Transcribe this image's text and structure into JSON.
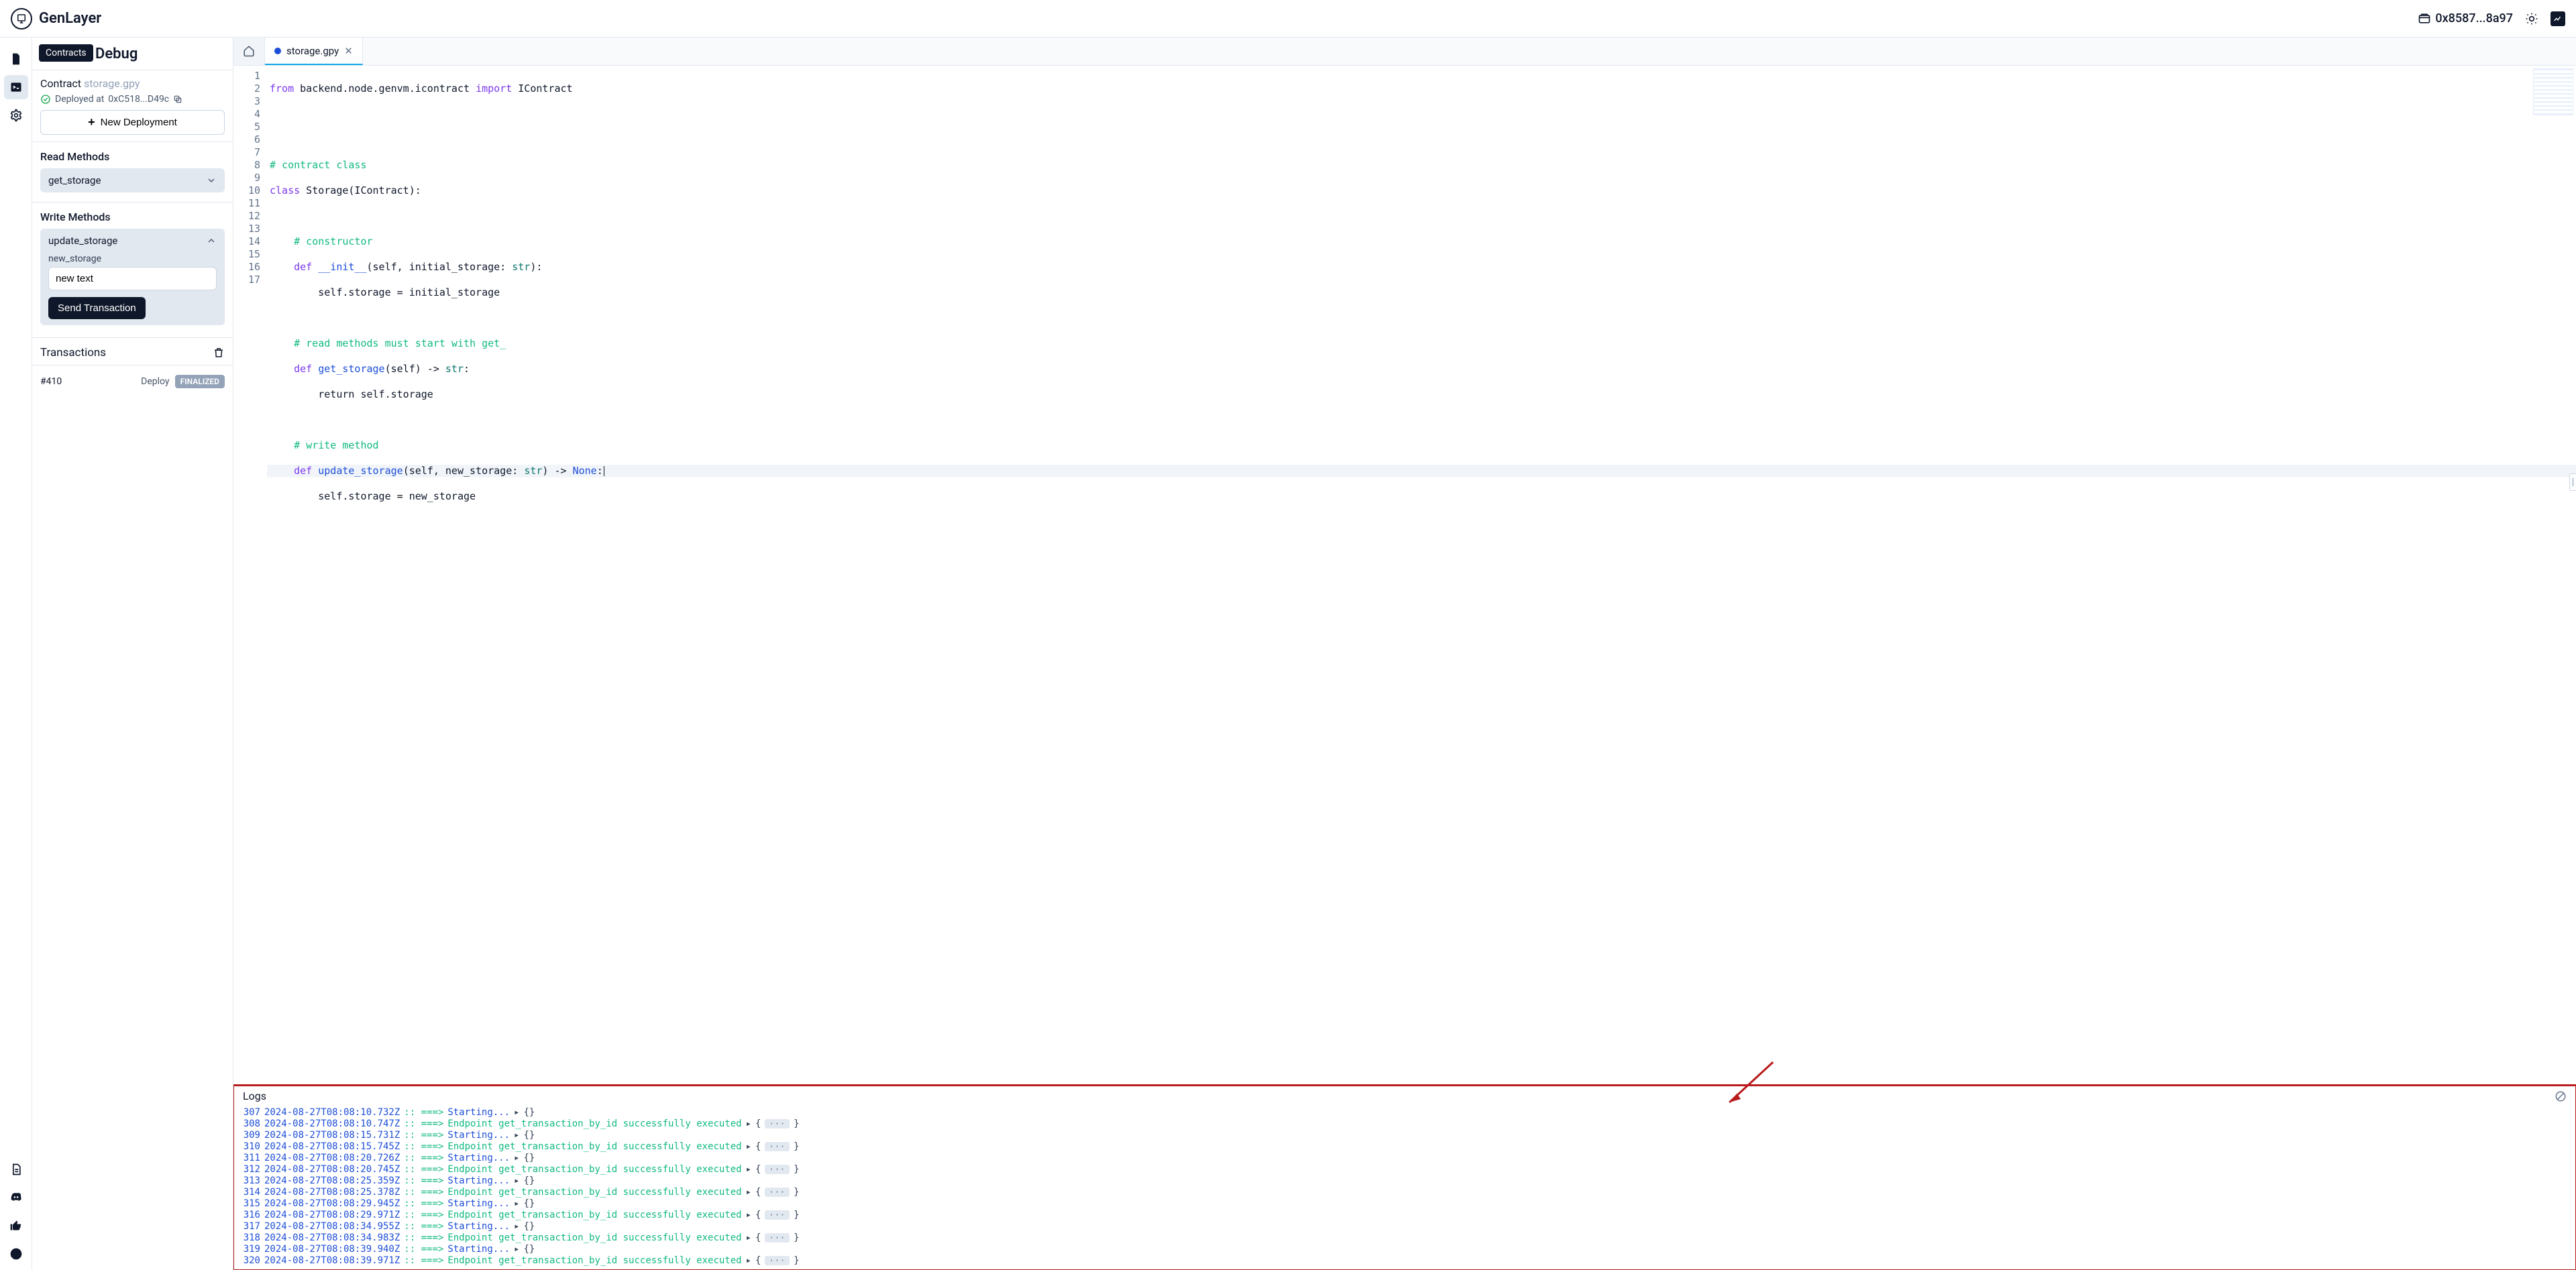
{
  "header": {
    "brand": "GenLayer",
    "wallet": "0x8587...8a97"
  },
  "tooltip": "Contracts",
  "sidebar": {
    "title": "Debug",
    "contract_label": "Contract",
    "contract_name": "storage.gpy",
    "deployed_prefix": "Deployed at",
    "deployed_addr": "0xC518...D49c",
    "new_deployment": "New Deployment",
    "read_methods_title": "Read Methods",
    "read_method": "get_storage",
    "write_methods_title": "Write Methods",
    "write_method": "update_storage",
    "param_label": "new_storage",
    "param_value": "new text",
    "send_btn": "Send Transaction",
    "tx_title": "Transactions",
    "tx_id": "#410",
    "tx_type": "Deploy",
    "tx_status": "FINALIZED"
  },
  "tabs": {
    "file": "storage.gpy"
  },
  "code": {
    "l1": {
      "a": "from",
      "b": " backend.node.genvm.icontract ",
      "c": "import",
      "d": " IContract"
    },
    "l2": "",
    "l3": "",
    "l4": "# contract class",
    "l5": {
      "a": "class",
      "b": " Storage(IContract):"
    },
    "l6": "",
    "l7": "    # constructor",
    "l8": {
      "a": "    def ",
      "b": "__init__",
      "c": "(self, initial_storage: ",
      "d": "str",
      "e": "):"
    },
    "l9": "        self.storage = initial_storage",
    "l10": "",
    "l11": "    # read methods must start with get_",
    "l12": {
      "a": "    def ",
      "b": "get_storage",
      "c": "(self) -> ",
      "d": "str",
      "e": ":"
    },
    "l13": "        return self.storage",
    "l14": "",
    "l15": "    # write method",
    "l16": {
      "a": "    def ",
      "b": "update_storage",
      "c": "(self, new_storage: ",
      "d": "str",
      "e": ") -> ",
      "f": "None",
      "g": ":"
    },
    "l17": "        self.storage = new_storage"
  },
  "logs": {
    "title": "Logs",
    "arrow": ":: ===>",
    "starting": "Starting...",
    "endpoint": "Endpoint get_transaction_by_id successfully executed",
    "rows": [
      {
        "n": "307",
        "ts": "2024-08-27T08:08:10.732Z",
        "kind": "start"
      },
      {
        "n": "308",
        "ts": "2024-08-27T08:08:10.747Z",
        "kind": "endpoint"
      },
      {
        "n": "309",
        "ts": "2024-08-27T08:08:15.731Z",
        "kind": "start"
      },
      {
        "n": "310",
        "ts": "2024-08-27T08:08:15.745Z",
        "kind": "endpoint"
      },
      {
        "n": "311",
        "ts": "2024-08-27T08:08:20.726Z",
        "kind": "start"
      },
      {
        "n": "312",
        "ts": "2024-08-27T08:08:20.745Z",
        "kind": "endpoint"
      },
      {
        "n": "313",
        "ts": "2024-08-27T08:08:25.359Z",
        "kind": "start"
      },
      {
        "n": "314",
        "ts": "2024-08-27T08:08:25.378Z",
        "kind": "endpoint"
      },
      {
        "n": "315",
        "ts": "2024-08-27T08:08:29.945Z",
        "kind": "start"
      },
      {
        "n": "316",
        "ts": "2024-08-27T08:08:29.971Z",
        "kind": "endpoint"
      },
      {
        "n": "317",
        "ts": "2024-08-27T08:08:34.955Z",
        "kind": "start"
      },
      {
        "n": "318",
        "ts": "2024-08-27T08:08:34.983Z",
        "kind": "endpoint"
      },
      {
        "n": "319",
        "ts": "2024-08-27T08:08:39.940Z",
        "kind": "start"
      },
      {
        "n": "320",
        "ts": "2024-08-27T08:08:39.971Z",
        "kind": "endpoint"
      }
    ]
  }
}
